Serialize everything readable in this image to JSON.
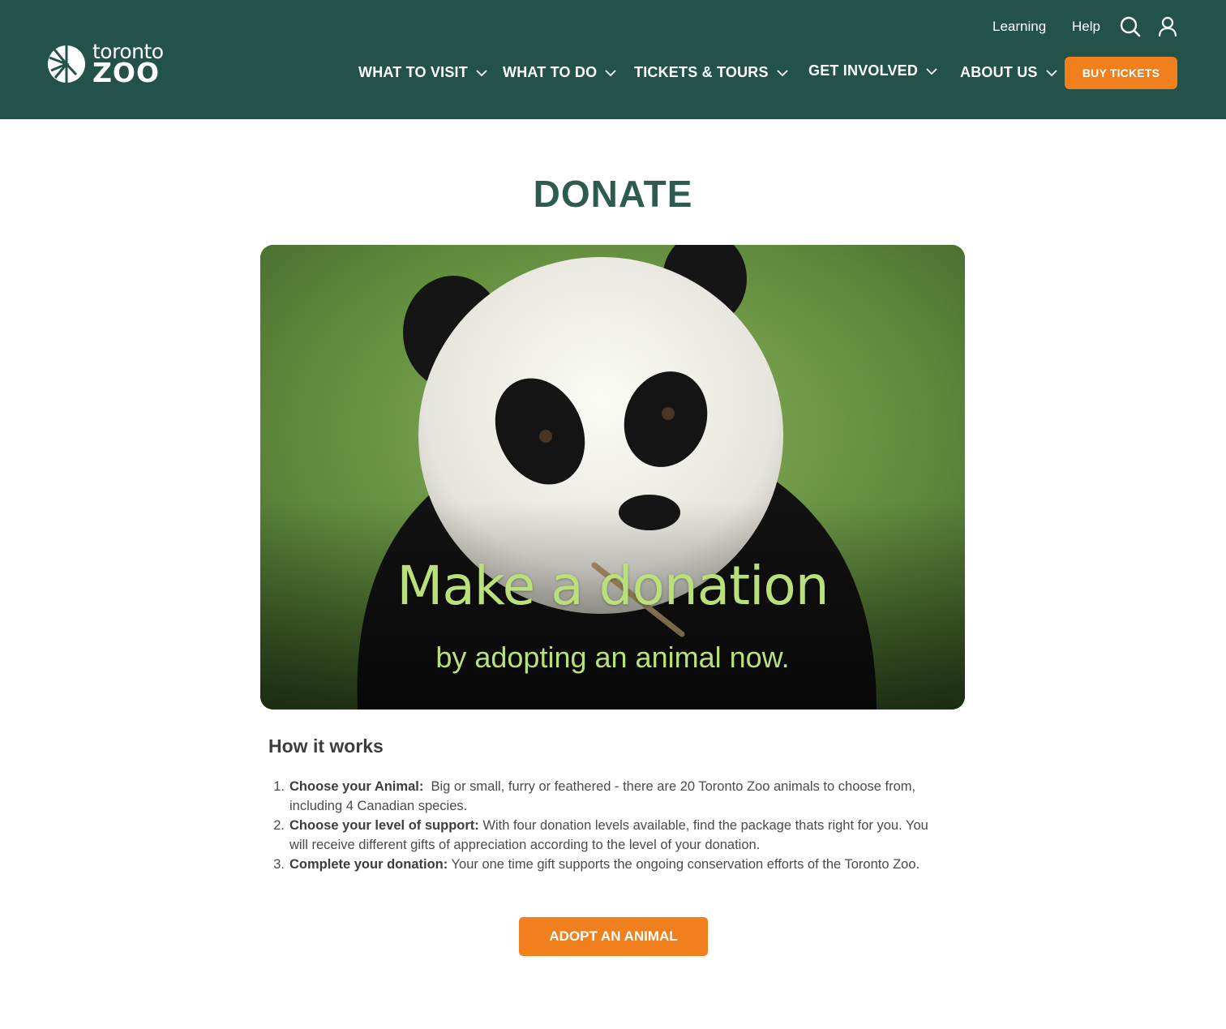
{
  "brand": {
    "logo_line1": "toronto",
    "logo_line2": "ZOO"
  },
  "utility_nav": {
    "learning": "Learning",
    "help": "Help"
  },
  "main_nav": [
    {
      "label": "WHAT TO VISIT"
    },
    {
      "label": "WHAT TO DO"
    },
    {
      "label": "TICKETS & TOURS"
    },
    {
      "label": "GET INVOLVED"
    },
    {
      "label": "ABOUT US"
    }
  ],
  "buy_tickets_label": "BUY TICKETS",
  "page_title": "DONATE",
  "hero": {
    "headline": "Make a donation",
    "subline": "by adopting an animal now."
  },
  "how_it_works": {
    "title": "How it works",
    "steps": [
      {
        "num": "1.",
        "bold": "Choose your Animal:",
        "text": "  Big or small, furry or feathered - there are 20 Toronto Zoo animals to choose from, including 4 Canadian species."
      },
      {
        "num": "2.",
        "bold": "Choose your level of support:",
        "text": " With four donation levels available, find the package thats right for you. You will receive different gifts of appreciation according to the level of your donation."
      },
      {
        "num": "3.",
        "bold": "Complete your donation:",
        "text": " Your one time gift supports the ongoing conservation efforts of the Toronto Zoo."
      }
    ]
  },
  "adopt_button_label": "ADOPT AN ANIMAL",
  "colors": {
    "header_bg": "#235248",
    "accent_orange": "#f07f1e",
    "title_green": "#2e5a50",
    "hero_text": "#b9e07a"
  },
  "icons": [
    "zoo-logo-icon",
    "search-icon",
    "user-icon",
    "chevron-down-icon"
  ]
}
